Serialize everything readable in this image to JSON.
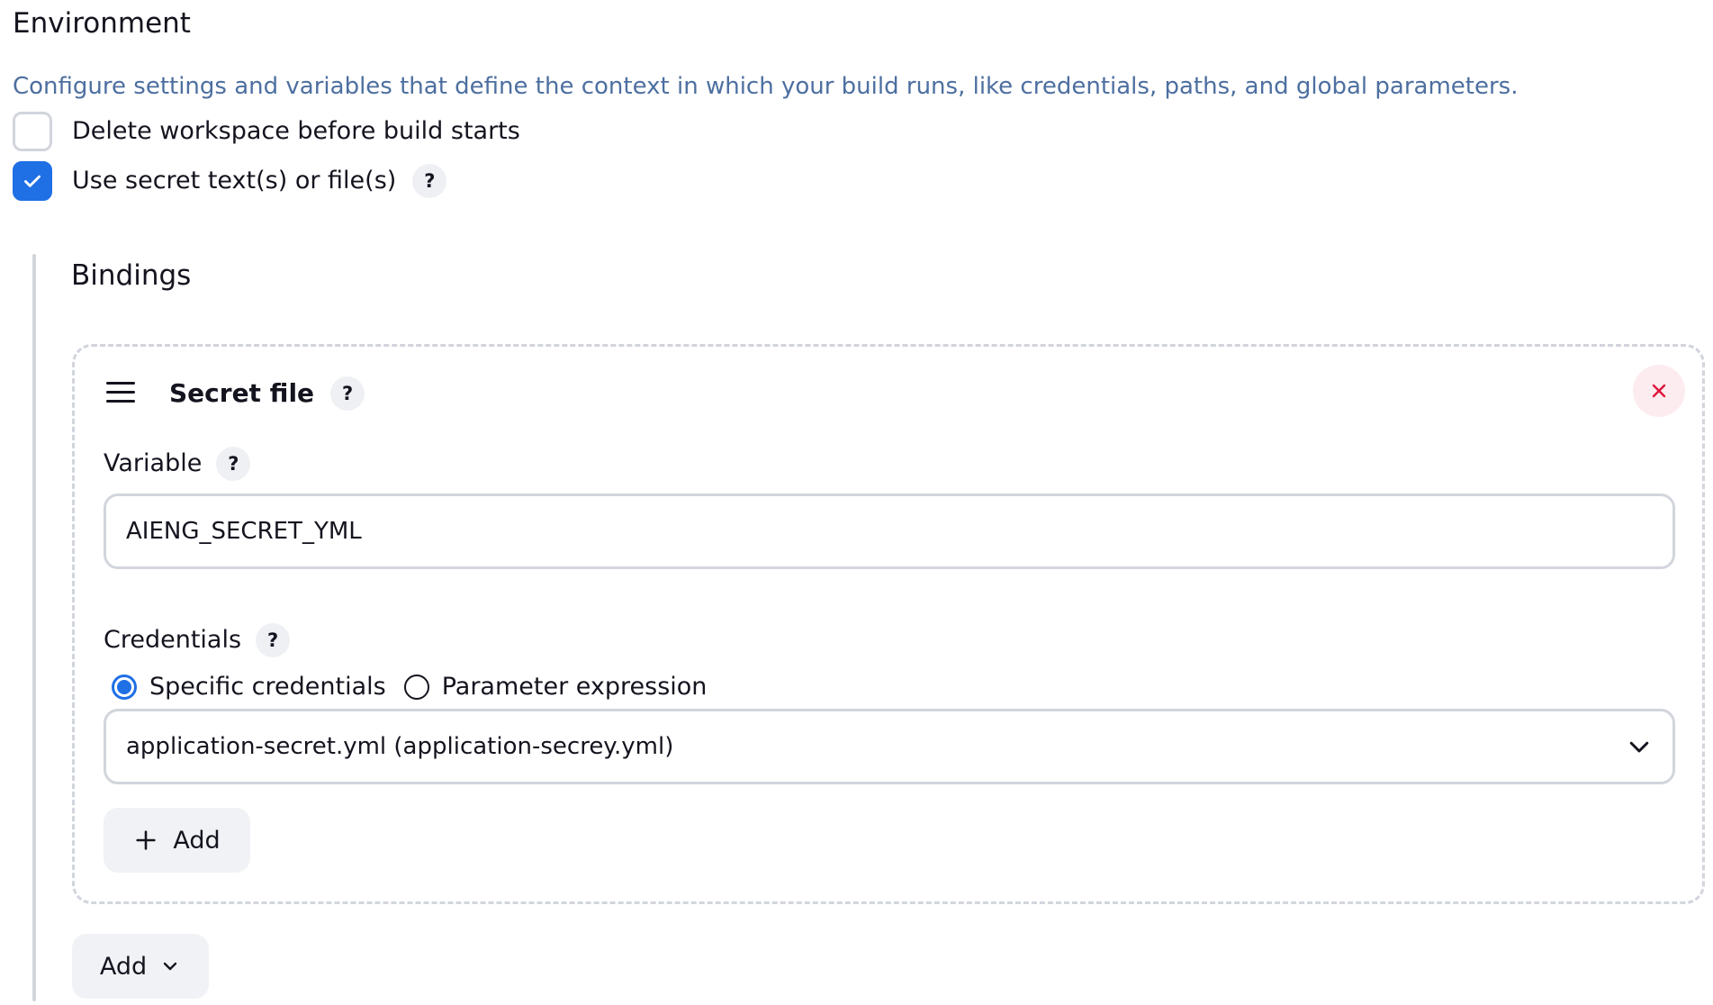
{
  "section": {
    "title": "Environment",
    "description": "Configure settings and variables that define the context in which your build runs, like credentials, paths, and global parameters."
  },
  "options": {
    "delete_workspace": {
      "label": "Delete workspace before build starts",
      "checked": false
    },
    "use_secret": {
      "label": "Use secret text(s) or file(s)",
      "checked": true,
      "help": "?"
    }
  },
  "bindings": {
    "title": "Bindings",
    "items": [
      {
        "type_label": "Secret file",
        "help": "?",
        "variable_label": "Variable",
        "variable_help": "?",
        "variable_value": "AIENG_SECRET_YML",
        "credentials_label": "Credentials",
        "credentials_help": "?",
        "radio_specific": "Specific credentials",
        "radio_parameter": "Parameter expression",
        "selected_radio": "specific",
        "credential_selected": "application-secret.yml (application-secrey.yml)",
        "add_label": "Add"
      }
    ],
    "add_label": "Add"
  },
  "colors": {
    "accent": "#1f6fe5",
    "description_text": "#4d6fa0",
    "border": "#d2d5dc",
    "close_icon": "#e0143c"
  }
}
